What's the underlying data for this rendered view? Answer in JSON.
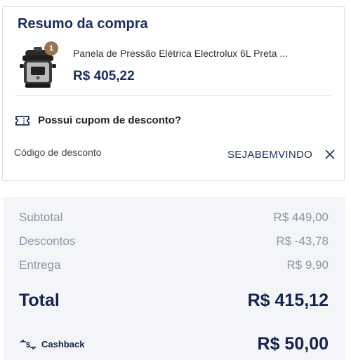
{
  "summary_card": {
    "title": "Resumo da compra",
    "product": {
      "name": "Panela de Pressão Elétrica Electrolux 6L Preta ...",
      "price": "R$ 405,22",
      "quantity": "1"
    },
    "coupon": {
      "question": "Possui cupom de desconto?",
      "code_label": "Código de desconto",
      "code_value": "SEJABEMVINDO",
      "remove_icon": "close-icon",
      "ticket_icon": "ticket-icon"
    }
  },
  "totals": {
    "subtotal_label": "Subtotal",
    "subtotal_value": "R$ 449,00",
    "discounts_label": "Descontos",
    "discounts_value": "R$ -43,78",
    "delivery_label": "Entrega",
    "delivery_value": "R$ 9,90",
    "total_label": "Total",
    "total_value": "R$ 415,12",
    "cashback_label": "Cashback",
    "cashback_value": "R$ 50,00",
    "cashback_icon": "cashback-icon"
  },
  "colors": {
    "primary": "#1a2e5c",
    "badge": "#9a7454",
    "summary_bg": "#f3f5f8",
    "muted_text": "#8d95a6"
  }
}
